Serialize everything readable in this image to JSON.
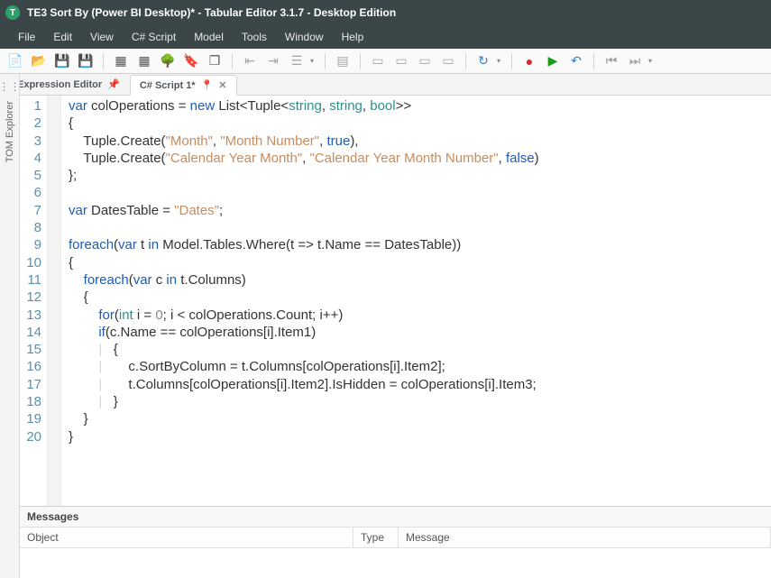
{
  "titlebar": {
    "text": "TE3 Sort By (Power BI Desktop)* - Tabular Editor 3.1.7 - Desktop Edition",
    "icon_label": "T"
  },
  "menubar": [
    "File",
    "Edit",
    "View",
    "C# Script",
    "Model",
    "Tools",
    "Window",
    "Help"
  ],
  "left_rail": {
    "label": "TOM Explorer"
  },
  "tabs": {
    "editor": {
      "label": "Expression Editor"
    },
    "script": {
      "label": "C# Script 1*"
    }
  },
  "code_lines": [
    [
      {
        "t": "kw",
        "v": "var"
      },
      {
        "t": "",
        "v": " colOperations = "
      },
      {
        "t": "kw",
        "v": "new"
      },
      {
        "t": "",
        "v": " List<Tuple<"
      },
      {
        "t": "type",
        "v": "string"
      },
      {
        "t": "",
        "v": ", "
      },
      {
        "t": "type",
        "v": "string"
      },
      {
        "t": "",
        "v": ", "
      },
      {
        "t": "type",
        "v": "bool"
      },
      {
        "t": "",
        "v": ">>"
      }
    ],
    [
      {
        "t": "",
        "v": "{"
      }
    ],
    [
      {
        "t": "",
        "v": "    Tuple.Create("
      },
      {
        "t": "str",
        "v": "\"Month\""
      },
      {
        "t": "",
        "v": ", "
      },
      {
        "t": "str",
        "v": "\"Month Number\""
      },
      {
        "t": "",
        "v": ", "
      },
      {
        "t": "kw",
        "v": "true"
      },
      {
        "t": "",
        "v": "),"
      }
    ],
    [
      {
        "t": "",
        "v": "    Tuple.Create("
      },
      {
        "t": "str",
        "v": "\"Calendar Year Month\""
      },
      {
        "t": "",
        "v": ", "
      },
      {
        "t": "str",
        "v": "\"Calendar Year Month Number\""
      },
      {
        "t": "",
        "v": ", "
      },
      {
        "t": "kw",
        "v": "false"
      },
      {
        "t": "",
        "v": ")"
      }
    ],
    [
      {
        "t": "",
        "v": "};"
      }
    ],
    [
      {
        "t": "",
        "v": ""
      }
    ],
    [
      {
        "t": "kw",
        "v": "var"
      },
      {
        "t": "",
        "v": " DatesTable = "
      },
      {
        "t": "str",
        "v": "\"Dates\""
      },
      {
        "t": "",
        "v": ";"
      }
    ],
    [
      {
        "t": "",
        "v": ""
      }
    ],
    [
      {
        "t": "kw",
        "v": "foreach"
      },
      {
        "t": "",
        "v": "("
      },
      {
        "t": "kw",
        "v": "var"
      },
      {
        "t": "",
        "v": " t "
      },
      {
        "t": "kw",
        "v": "in"
      },
      {
        "t": "",
        "v": " Model.Tables.Where(t => t.Name == DatesTable))"
      }
    ],
    [
      {
        "t": "",
        "v": "{"
      }
    ],
    [
      {
        "t": "",
        "v": "    "
      },
      {
        "t": "kw",
        "v": "foreach"
      },
      {
        "t": "",
        "v": "("
      },
      {
        "t": "kw",
        "v": "var"
      },
      {
        "t": "",
        "v": " c "
      },
      {
        "t": "kw",
        "v": "in"
      },
      {
        "t": "",
        "v": " t.Columns)"
      }
    ],
    [
      {
        "t": "",
        "v": "    {"
      }
    ],
    [
      {
        "t": "",
        "v": "        "
      },
      {
        "t": "kw",
        "v": "for"
      },
      {
        "t": "",
        "v": "("
      },
      {
        "t": "type",
        "v": "int"
      },
      {
        "t": "",
        "v": " i = "
      },
      {
        "t": "num",
        "v": "0"
      },
      {
        "t": "",
        "v": "; i < colOperations.Count; i++)"
      }
    ],
    [
      {
        "t": "",
        "v": "        "
      },
      {
        "t": "kw",
        "v": "if"
      },
      {
        "t": "",
        "v": "(c.Name == colOperations[i].Item1)"
      }
    ],
    [
      {
        "t": "",
        "v": "        "
      },
      {
        "t": "ind-guide",
        "v": "|   "
      },
      {
        "t": "",
        "v": "{"
      }
    ],
    [
      {
        "t": "",
        "v": "        "
      },
      {
        "t": "ind-guide",
        "v": "|   "
      },
      {
        "t": "",
        "v": "    c.SortByColumn = t.Columns[colOperations[i].Item2];"
      }
    ],
    [
      {
        "t": "",
        "v": "        "
      },
      {
        "t": "ind-guide",
        "v": "|   "
      },
      {
        "t": "",
        "v": "    t.Columns[colOperations[i].Item2].IsHidden = colOperations[i].Item3;"
      }
    ],
    [
      {
        "t": "",
        "v": "        "
      },
      {
        "t": "ind-guide",
        "v": "|   "
      },
      {
        "t": "",
        "v": "}"
      }
    ],
    [
      {
        "t": "",
        "v": "    }"
      }
    ],
    [
      {
        "t": "",
        "v": "}"
      }
    ]
  ],
  "messages": {
    "title": "Messages",
    "columns": {
      "object": "Object",
      "type": "Type",
      "message": "Message"
    }
  }
}
